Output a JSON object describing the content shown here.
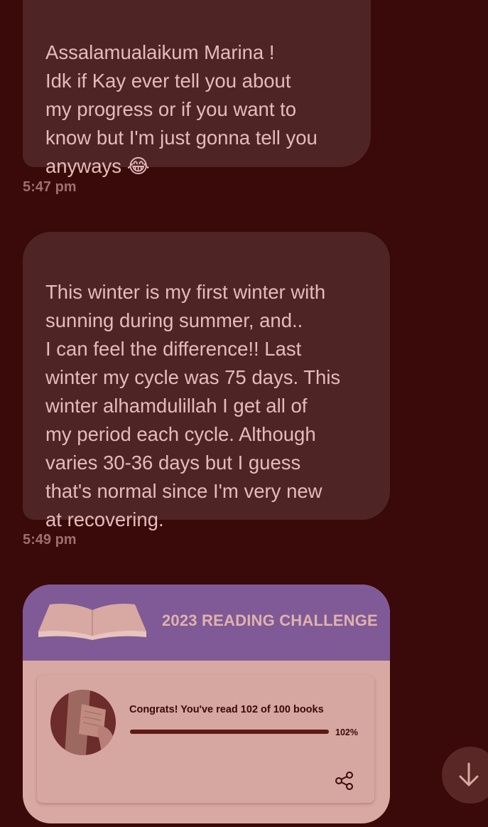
{
  "messages": [
    {
      "text": "Assalamualaikum Marina !\nIdk if Kay ever tell you about\nmy progress or if you want to\nknow but I'm just gonna tell you\nanyways 😂",
      "time": "5:47 pm"
    },
    {
      "text": "This winter is my first winter with\nsunning during summer, and..\nI can feel the difference!! Last\nwinter my cycle was 75 days. This\nwinter alhamdulillah I get all of\nmy period each cycle. Although\nvaries 30-36 days but I guess\nthat's normal since I'm very new\nat recovering.",
      "time": "5:49 pm"
    }
  ],
  "reading_card": {
    "title": "2023 READING CHALLENGE",
    "progress_text": "Congrats! You've read 102 of 100 books",
    "progress_percent_label": "102%",
    "progress_fraction": 1.0,
    "book_icon": "open-book-icon",
    "share_icon": "share-icon",
    "colors": {
      "header": "#7f5a96",
      "body": "#d8a9a2",
      "bar_fill": "#5e1a12"
    }
  },
  "scroll_button": {
    "icon": "arrow-down-icon"
  },
  "colors": {
    "background": "#3a0909",
    "bubble": "#4f2424",
    "text": "#e4bcbc",
    "timestamp": "#9e6e6e"
  }
}
